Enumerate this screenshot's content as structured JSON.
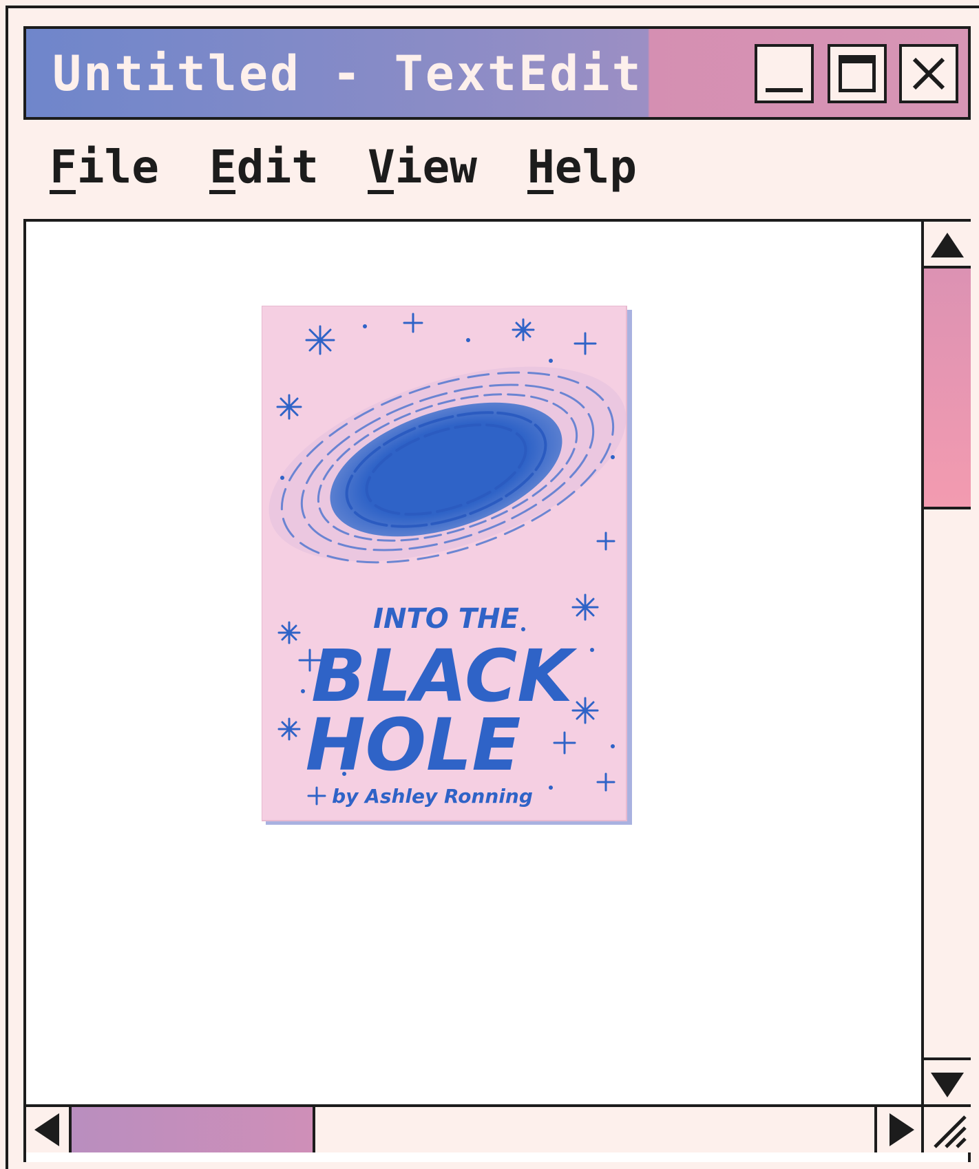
{
  "window": {
    "title": "Untitled - TextEdit",
    "controls": {
      "minimize": "minimize",
      "maximize": "maximize",
      "close": "close"
    }
  },
  "menu": {
    "items": [
      {
        "label": "File"
      },
      {
        "label": "Edit"
      },
      {
        "label": "View"
      },
      {
        "label": "Help"
      }
    ]
  },
  "document": {
    "cover": {
      "line1": "INTO THE",
      "line2": "BLACK",
      "line3": "HOLE",
      "byline": "by Ashley Ronning"
    }
  },
  "colors": {
    "title_gradient_start": "#6f86cb",
    "title_gradient_pink": "#d795b5",
    "scroll_thumb_v": "#f39bb0",
    "scroll_thumb_h": "#c18fbd",
    "cover_pink": "#f5cfe2",
    "cover_blue": "#2f63c7",
    "background": "#fdf0ec"
  },
  "icons": [
    "minimize-icon",
    "maximize-icon",
    "close-icon",
    "arrow-up-icon",
    "arrow-down-icon",
    "arrow-left-icon",
    "arrow-right-icon",
    "resize-grip-icon"
  ]
}
